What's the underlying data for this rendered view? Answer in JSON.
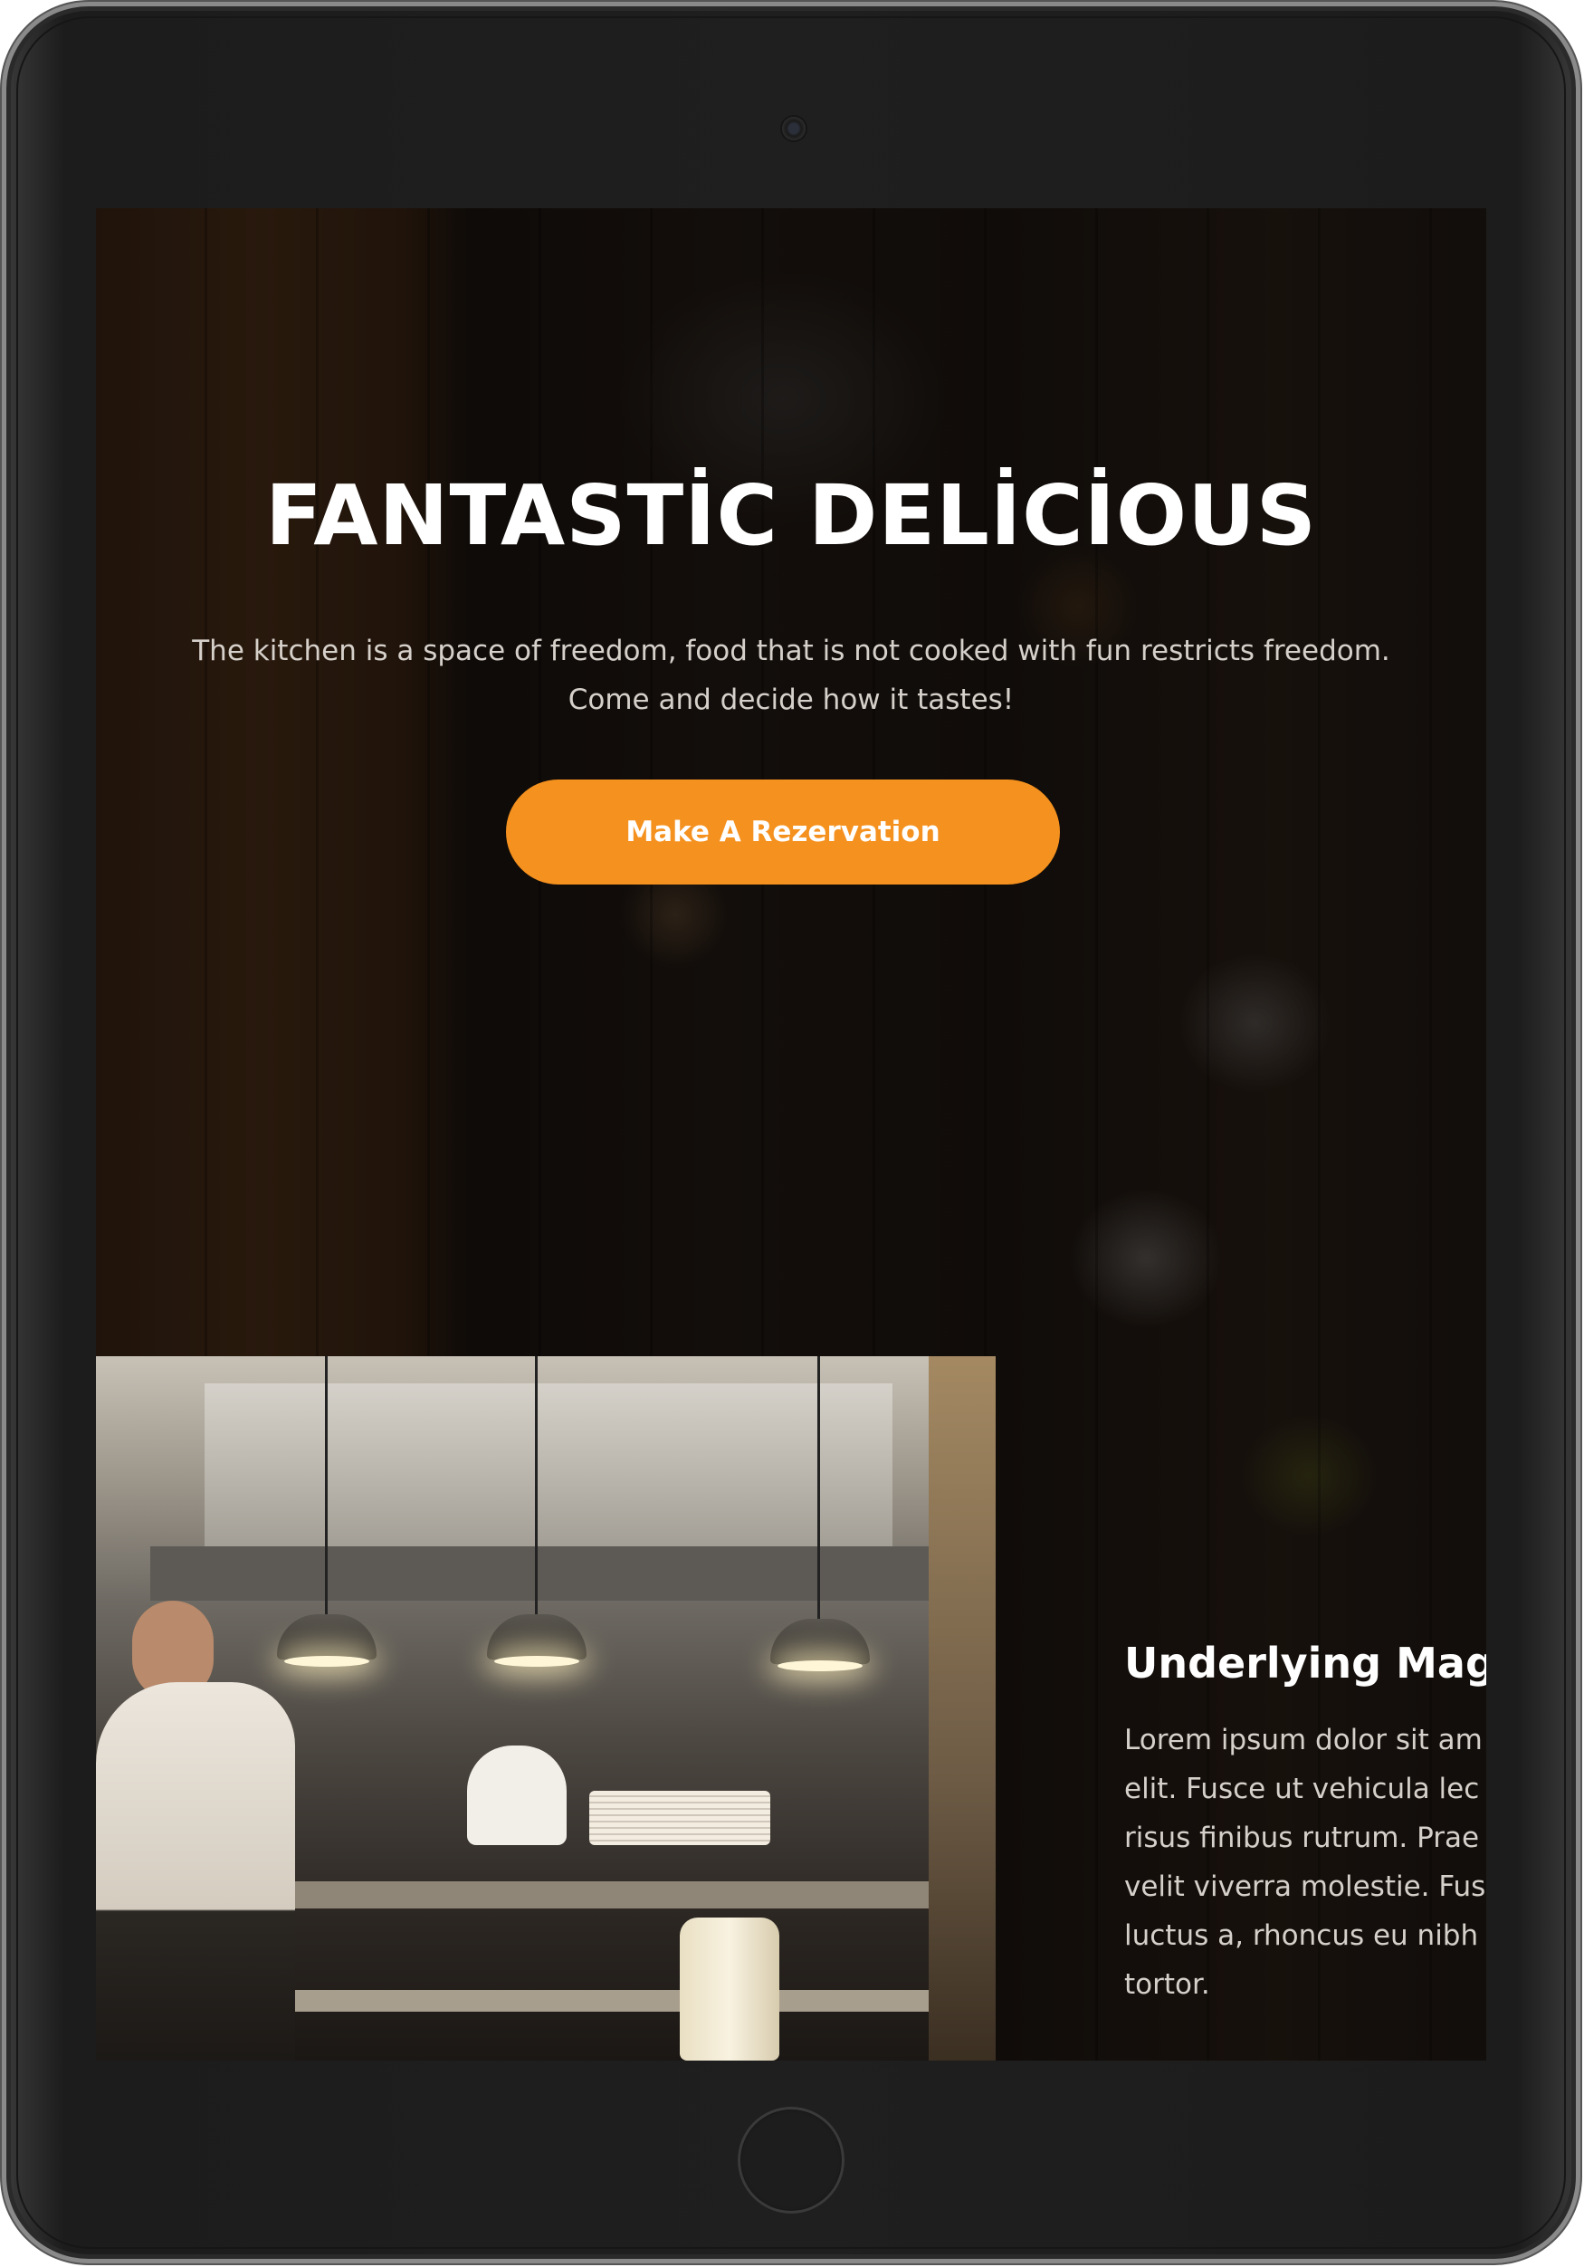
{
  "hero": {
    "title": "FANTASTİC DELİCİOUS",
    "text_line1": "The kitchen is a space of freedom, food that is not cooked with fun restricts freedom.",
    "text_line2": "Come and decide how it tastes!",
    "cta_label": "Make A Rezervation"
  },
  "about": {
    "title": "Underlying Mag",
    "lines": [
      "Lorem ipsum dolor sit am",
      "elit. Fusce ut vehicula lec",
      "risus finibus rutrum. Prae",
      "velit viverra molestie. Fus",
      "luctus a, rhoncus eu nibh",
      "tortor."
    ]
  },
  "colors": {
    "accent": "#f5911e",
    "device_frame": "#1f1f1f",
    "text_light": "#d6d0ca"
  },
  "icons": {
    "camera": "front-camera-icon",
    "home": "home-button-icon"
  }
}
